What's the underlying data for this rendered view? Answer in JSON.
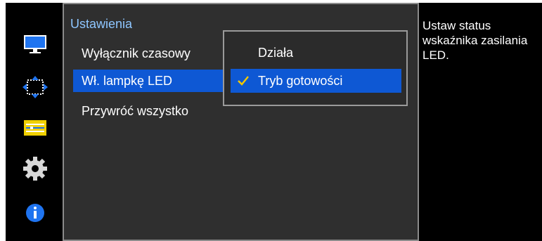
{
  "menu": {
    "title": "Ustawienia",
    "items": [
      {
        "label": "Wyłącznik czasowy"
      },
      {
        "label": "Wł. lampkę LED"
      },
      {
        "label": "Przywróć wszystko"
      }
    ],
    "selected_index": 1
  },
  "submenu": {
    "options": [
      {
        "label": "Działa"
      },
      {
        "label": "Tryb gotowości"
      }
    ],
    "selected_index": 1
  },
  "help": {
    "text": "Ustaw status wskaźnika zasilania LED."
  },
  "icons": [
    "monitor-icon",
    "size-position-icon",
    "settings-sliders-icon",
    "gear-icon",
    "info-icon"
  ],
  "colors": {
    "selection": "#0e58d4",
    "title": "#8ec6ff",
    "panel": "#2f2f2f",
    "background": "#000000"
  }
}
